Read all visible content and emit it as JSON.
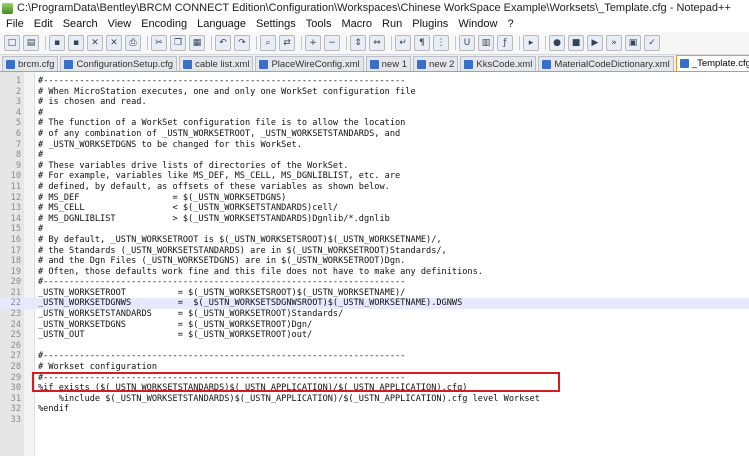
{
  "window": {
    "title": "C:\\ProgramData\\Bentley\\BRCM CONNECT Edition\\Configuration\\Workspaces\\Chinese WorkSpace Example\\Worksets\\_Template.cfg - Notepad++"
  },
  "menu": {
    "items": [
      "File",
      "Edit",
      "Search",
      "View",
      "Encoding",
      "Language",
      "Settings",
      "Tools",
      "Macro",
      "Run",
      "Plugins",
      "Window",
      "?"
    ]
  },
  "toolbar": {
    "buttons": [
      "new-icon",
      "open-icon",
      "save-icon",
      "save-all-icon",
      "close-icon",
      "close-all-icon",
      "print-icon",
      "cut-icon",
      "copy-icon",
      "paste-icon",
      "undo-icon",
      "redo-icon",
      "find-icon",
      "replace-icon",
      "zoom-in-icon",
      "zoom-out-icon",
      "sync-v-icon",
      "sync-h-icon",
      "word-wrap-icon",
      "all-chars-icon",
      "indent-guide-icon",
      "udl-icon",
      "doc-map-icon",
      "function-list-icon",
      "folder-workspace-icon",
      "record-macro-icon",
      "stop-macro-icon",
      "play-macro-icon",
      "run-macro-icon",
      "save-macro-icon",
      "spellcheck-icon"
    ]
  },
  "tabs": [
    {
      "label": "brcm.cfg",
      "active": false
    },
    {
      "label": "ConfigurationSetup.cfg",
      "active": false
    },
    {
      "label": "cable list.xml",
      "active": false
    },
    {
      "label": "PlaceWireConfig.xml",
      "active": false
    },
    {
      "label": "new 1",
      "active": false
    },
    {
      "label": "new 2",
      "active": false
    },
    {
      "label": "KksCode.xml",
      "active": false
    },
    {
      "label": "MaterialCodeDictionary.xml",
      "active": false
    },
    {
      "label": "_Template.cfg",
      "active": true
    }
  ],
  "editor": {
    "current_line": 22,
    "lines": [
      {
        "n": "1",
        "text": "#----------------------------------------------------------------------"
      },
      {
        "n": "2",
        "text": "# When MicroStation executes, one and only one WorkSet configuration file"
      },
      {
        "n": "3",
        "text": "# is chosen and read."
      },
      {
        "n": "4",
        "text": "#"
      },
      {
        "n": "5",
        "text": "# The function of a WorkSet configuration file is to allow the location"
      },
      {
        "n": "6",
        "text": "# of any combination of _USTN_WORKSETROOT, _USTN_WORKSETSTANDARDS, and"
      },
      {
        "n": "7",
        "text": "# _USTN_WORKSETDGNS to be changed for this WorkSet."
      },
      {
        "n": "8",
        "text": "#"
      },
      {
        "n": "9",
        "text": "# These variables drive lists of directories of the WorkSet."
      },
      {
        "n": "10",
        "text": "# For example, variables like MS_DEF, MS_CELL, MS_DGNLIBLIST, etc. are"
      },
      {
        "n": "11",
        "text": "# defined, by default, as offsets of these variables as shown below."
      },
      {
        "n": "12",
        "text": "# MS_DEF                  = $(_USTN_WORKSETDGNS)"
      },
      {
        "n": "13",
        "text": "# MS_CELL                 < $(_USTN_WORKSETSTANDARDS)cell/"
      },
      {
        "n": "14",
        "text": "# MS_DGNLIBLIST           > $(_USTN_WORKSETSTANDARDS)Dgnlib/*.dgnlib"
      },
      {
        "n": "15",
        "text": "#"
      },
      {
        "n": "16",
        "text": "# By default, _USTN_WORKSETROOT is $(_USTN_WORKSETSROOT)$(_USTN_WORKSETNAME)/,"
      },
      {
        "n": "17",
        "text": "# the Standards (_USTN_WORKSETSTANDARDS) are in $(_USTN_WORKSETROOT)Standards/,"
      },
      {
        "n": "18",
        "text": "# and the Dgn Files (_USTN_WORKSETDGNS) are in $(_USTN_WORKSETROOT)Dgn."
      },
      {
        "n": "19",
        "text": "# Often, those defaults work fine and this file does not have to make any definitions."
      },
      {
        "n": "20",
        "text": "#----------------------------------------------------------------------"
      },
      {
        "n": "21",
        "text": "_USTN_WORKSETROOT          = $(_USTN_WORKSETSROOT)$(_USTN_WORKSETNAME)/"
      },
      {
        "n": "22",
        "text": "_USTN_WORKSETDGNWS         =  $(_USTN_WORKSETSDGNWSROOT)$(_USTN_WORKSETNAME).DGNWS"
      },
      {
        "n": "23",
        "text": "_USTN_WORKSETSTANDARDS     = $(_USTN_WORKSETROOT)Standards/"
      },
      {
        "n": "24",
        "text": "_USTN_WORKSETDGNS          = $(_USTN_WORKSETROOT)Dgn/"
      },
      {
        "n": "25",
        "text": "_USTN_OUT                  = $(_USTN_WORKSETROOT)out/"
      },
      {
        "n": "26",
        "text": ""
      },
      {
        "n": "27",
        "text": "#----------------------------------------------------------------------"
      },
      {
        "n": "28",
        "text": "# Workset configuration"
      },
      {
        "n": "29",
        "text": "#----------------------------------------------------------------------"
      },
      {
        "n": "30",
        "text": "%if exists ($(_USTN_WORKSETSTANDARDS)$(_USTN_APPLICATION)/$(_USTN_APPLICATION).cfg)"
      },
      {
        "n": "31",
        "text": "    %include $(_USTN_WORKSETSTANDARDS)$(_USTN_APPLICATION)/$(_USTN_APPLICATION).cfg level Workset"
      },
      {
        "n": "32",
        "text": "%endif"
      },
      {
        "n": "33",
        "text": ""
      }
    ]
  },
  "colors": {
    "highlight_box": "#d81b22",
    "active_tab_accent": "#f0a020",
    "current_line_bg": "#e8e8ff"
  }
}
